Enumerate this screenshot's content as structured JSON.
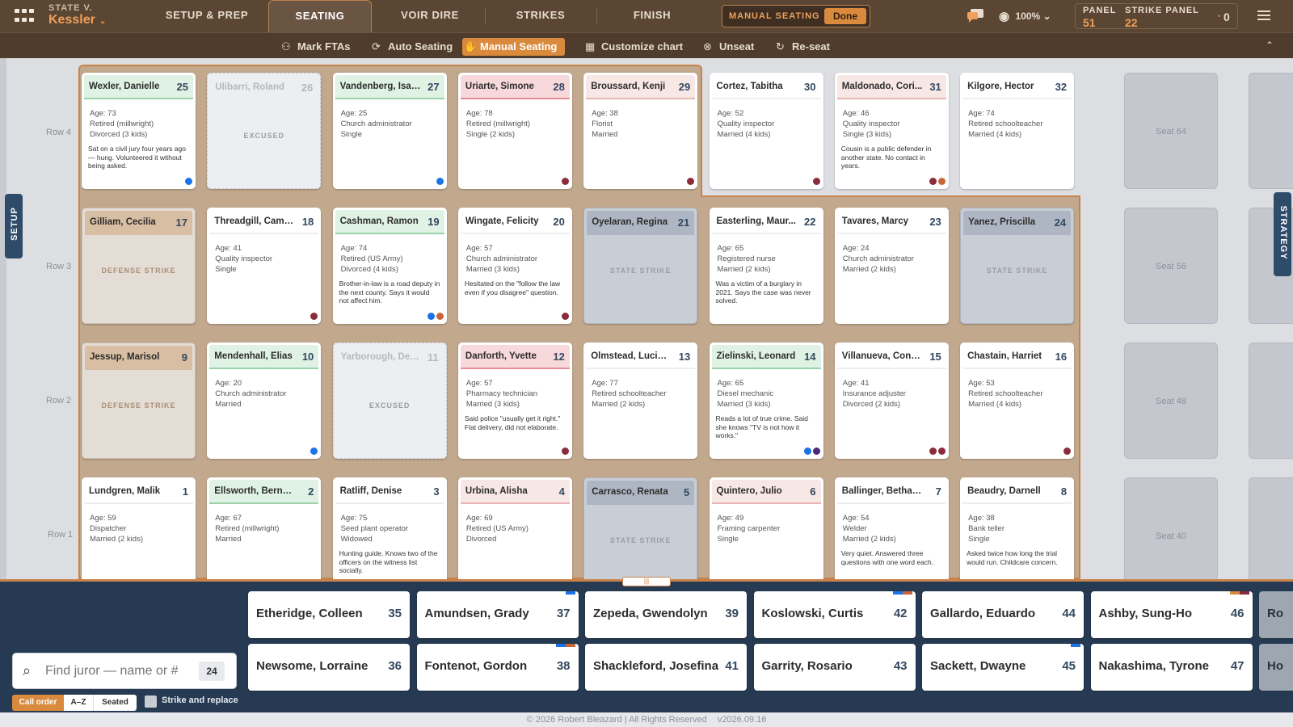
{
  "case": {
    "prefix": "STATE V.",
    "name": "Kessler"
  },
  "tabs": [
    "SETUP & PREP",
    "SEATING",
    "VOIR DIRE",
    "STRIKES",
    "FINISH"
  ],
  "mode": {
    "label": "MANUAL SEATING",
    "done": "Done"
  },
  "zoom": "100%",
  "panel": {
    "panel_label": "PANEL",
    "panel_value": "51",
    "strike_label": "STRIKE PANEL",
    "strike_value": "22",
    "alt_value": "0"
  },
  "subtoolbar": [
    "Mark FTAs",
    "Auto Seating",
    "Manual Seating",
    "Customize chart",
    "Unseat",
    "Re-seat"
  ],
  "rows": [
    "Row 4",
    "Row 3",
    "Row 2",
    "Row 1"
  ],
  "cards": {
    "r4": [
      {
        "name": "Wexler, Danielle",
        "seat": "25",
        "type": "green",
        "age": "Age: 73",
        "job": "Retired (millwright)",
        "fam": "Divorced (3 kids)",
        "note": "Sat on a civil jury four years ago — hung. Volunteered it without being asked.",
        "dots": [
          "#1a73e8"
        ]
      },
      {
        "name": "Ulibarri, Roland",
        "seat": "26",
        "status": "EXCUSED"
      },
      {
        "name": "Vandenberg, Isai...",
        "seat": "27",
        "type": "green",
        "age": "Age: 25",
        "job": "Church administrator",
        "fam": "Single",
        "note": "",
        "dots": [
          "#1a73e8"
        ]
      },
      {
        "name": "Uriarte, Simone",
        "seat": "28",
        "type": "pink",
        "age": "Age: 78",
        "job": "Retired (millwright)",
        "fam": "Single (2 kids)",
        "note": "",
        "dots": [
          "#8b2b3b"
        ]
      },
      {
        "name": "Broussard, Kenji",
        "seat": "29",
        "type": "peach",
        "age": "Age: 38",
        "job": "Florist",
        "fam": "Married",
        "note": "",
        "dots": [
          "#8b2b3b"
        ]
      },
      {
        "name": "Cortez, Tabitha",
        "seat": "30",
        "type": "plain",
        "age": "Age: 52",
        "job": "Quality inspector",
        "fam": "Married (4 kids)",
        "note": "",
        "dots": [
          "#8b2b3b"
        ]
      },
      {
        "name": "Maldonado, Cori...",
        "seat": "31",
        "type": "peach",
        "age": "Age: 46",
        "job": "Quality inspector",
        "fam": "Single (3 kids)",
        "note": "Cousin is a public defender in another state. No contact in years.",
        "dots": [
          "#8b2b3b",
          "#c8663a"
        ]
      },
      {
        "name": "Kilgore, Hector",
        "seat": "32",
        "type": "plain",
        "age": "Age: 74",
        "job": "Retired schoolteacher",
        "fam": "Married (4 kids)",
        "note": "",
        "dots": []
      }
    ],
    "r3": [
      {
        "name": "Gilliam, Cecilia",
        "seat": "17",
        "status": "DEFENSE STRIKE"
      },
      {
        "name": "Threadgill, Camille",
        "seat": "18",
        "type": "plain",
        "age": "Age: 41",
        "job": "Quality inspector",
        "fam": "Single",
        "note": "",
        "dots": [
          "#8b2b3b"
        ]
      },
      {
        "name": "Cashman, Ramon",
        "seat": "19",
        "type": "green",
        "age": "Age: 74",
        "job": "Retired (US Army)",
        "fam": "Divorced (4 kids)",
        "note": "Brother-in-law is a road deputy in the next county. Says it would not affect him.",
        "dots": [
          "#1a73e8",
          "#c8663a"
        ]
      },
      {
        "name": "Wingate, Felicity",
        "seat": "20",
        "type": "plain",
        "age": "Age: 57",
        "job": "Church administrator",
        "fam": "Married (3 kids)",
        "note": "Hesitated on the \"follow the law even if you disagree\" question.",
        "dots": [
          "#8b2b3b"
        ]
      },
      {
        "name": "Oyelaran, Regina",
        "seat": "21",
        "status": "STATE STRIKE"
      },
      {
        "name": "Easterling, Maur...",
        "seat": "22",
        "type": "plain",
        "age": "Age: 65",
        "job": "Registered nurse",
        "fam": "Married (2 kids)",
        "note": "Was a victim of a burglary in 2021. Says the case was never solved.",
        "dots": []
      },
      {
        "name": "Tavares, Marcy",
        "seat": "23",
        "type": "plain",
        "age": "Age: 24",
        "job": "Church administrator",
        "fam": "Married (2 kids)",
        "note": "",
        "dots": []
      },
      {
        "name": "Yanez, Priscilla",
        "seat": "24",
        "status": "STATE STRIKE"
      }
    ],
    "r2": [
      {
        "name": "Jessup, Marisol",
        "seat": "9",
        "status": "DEFENSE STRIKE"
      },
      {
        "name": "Mendenhall, Elias",
        "seat": "10",
        "type": "green",
        "age": "Age: 20",
        "job": "Church administrator",
        "fam": "Married",
        "note": "",
        "dots": [
          "#1a73e8"
        ]
      },
      {
        "name": "Yarborough, Deb...",
        "seat": "11",
        "status": "EXCUSED"
      },
      {
        "name": "Danforth, Yvette",
        "seat": "12",
        "type": "pink",
        "age": "Age: 57",
        "job": "Pharmacy technician",
        "fam": "Married (3 kids)",
        "note": "Said police \"usually get it right.\" Flat delivery, did not elaborate.",
        "dots": [
          "#8b2b3b"
        ]
      },
      {
        "name": "Olmstead, Lucinda",
        "seat": "13",
        "type": "plain",
        "age": "Age: 77",
        "job": "Retired schoolteacher",
        "fam": "Married (2 kids)",
        "note": "",
        "dots": []
      },
      {
        "name": "Zielinski, Leonard",
        "seat": "14",
        "type": "green",
        "age": "Age: 65",
        "job": "Diesel mechanic",
        "fam": "Married (3 kids)",
        "note": "Reads a lot of true crime. Said she knows \"TV is not how it works.\"",
        "dots": [
          "#1a73e8",
          "#4a2a78"
        ]
      },
      {
        "name": "Villanueva, Cons...",
        "seat": "15",
        "type": "plain",
        "age": "Age: 41",
        "job": "Insurance adjuster",
        "fam": "Divorced (2 kids)",
        "note": "",
        "dots": [
          "#8b2b3b",
          "#8b2b3b"
        ]
      },
      {
        "name": "Chastain, Harriet",
        "seat": "16",
        "type": "plain",
        "age": "Age: 53",
        "job": "Retired schoolteacher",
        "fam": "Married (4 kids)",
        "note": "",
        "dots": [
          "#8b2b3b"
        ]
      }
    ],
    "r1": [
      {
        "name": "Lundgren, Malik",
        "seat": "1",
        "type": "plain",
        "age": "Age: 59",
        "job": "Dispatcher",
        "fam": "Married (2 kids)",
        "note": "",
        "dots": []
      },
      {
        "name": "Ellsworth, Bernard",
        "seat": "2",
        "type": "green",
        "age": "Age: 67",
        "job": "Retired (millwright)",
        "fam": "Married",
        "note": "",
        "dots": []
      },
      {
        "name": "Ratliff, Denise",
        "seat": "3",
        "type": "plain",
        "age": "Age: 75",
        "job": "Seed plant operator",
        "fam": "Widowed",
        "note": "Hunting guide. Knows two of the officers on the witness list socially.",
        "dots": []
      },
      {
        "name": "Urbina, Alisha",
        "seat": "4",
        "type": "peach",
        "age": "Age: 69",
        "job": "Retired (US Army)",
        "fam": "Divorced",
        "note": "",
        "dots": []
      },
      {
        "name": "Carrasco, Renata",
        "seat": "5",
        "status": "STATE STRIKE"
      },
      {
        "name": "Quintero, Julio",
        "seat": "6",
        "type": "peach",
        "age": "Age: 49",
        "job": "Framing carpenter",
        "fam": "Single",
        "note": "",
        "dots": []
      },
      {
        "name": "Ballinger, Bethany",
        "seat": "7",
        "type": "plain",
        "age": "Age: 54",
        "job": "Welder",
        "fam": "Married (2 kids)",
        "note": "Very quiet. Answered three questions with one word each.",
        "dots": []
      },
      {
        "name": "Beaudry, Darnell",
        "seat": "8",
        "type": "plain",
        "age": "Age: 38",
        "job": "Bank teller",
        "fam": "Single",
        "note": "Asked twice how long the trial would run. Childcare concern.",
        "dots": []
      }
    ]
  },
  "empty_seats": [
    "Seat 64",
    "Seat 56",
    "Seat 48",
    "Seat 40"
  ],
  "side_tabs": {
    "left": "SETUP",
    "right": "STRATEGY"
  },
  "search": {
    "placeholder": "Find juror — name or #",
    "count": "24"
  },
  "sort": {
    "options": [
      "Call order",
      "A–Z",
      "Seated"
    ],
    "active": "Call order",
    "toggle": "Strike and replace"
  },
  "queue": {
    "top": [
      {
        "name": "Etheridge, Colleen",
        "num": "35",
        "flags": []
      },
      {
        "name": "Amundsen, Grady",
        "num": "37",
        "flags": [
          "#1a73e8"
        ]
      },
      {
        "name": "Zepeda, Gwendolyn",
        "num": "39",
        "flags": []
      },
      {
        "name": "Koslowski, Curtis",
        "num": "42",
        "flags": [
          "#1a73e8",
          "#c8663a"
        ]
      },
      {
        "name": "Gallardo, Eduardo",
        "num": "44",
        "flags": []
      },
      {
        "name": "Ashby, Sung-Ho",
        "num": "46",
        "flags": [
          "#d98a3d",
          "#8b2b3b"
        ]
      },
      {
        "name": "Ro",
        "num": "",
        "flags": []
      }
    ],
    "bottom": [
      {
        "name": "Newsome, Lorraine",
        "num": "36",
        "flags": []
      },
      {
        "name": "Fontenot, Gordon",
        "num": "38",
        "flags": [
          "#1a73e8",
          "#c8663a"
        ]
      },
      {
        "name": "Shackleford, Josefina",
        "num": "41",
        "flags": []
      },
      {
        "name": "Garrity, Rosario",
        "num": "43",
        "flags": []
      },
      {
        "name": "Sackett, Dwayne",
        "num": "45",
        "flags": [
          "#1a73e8"
        ]
      },
      {
        "name": "Nakashima, Tyrone",
        "num": "47",
        "flags": []
      },
      {
        "name": "Ho",
        "num": "",
        "flags": []
      }
    ]
  },
  "footer": {
    "copyright": "© 2026 Robert Bleazard | All Rights Reserved",
    "version": "v2026.09.16"
  }
}
